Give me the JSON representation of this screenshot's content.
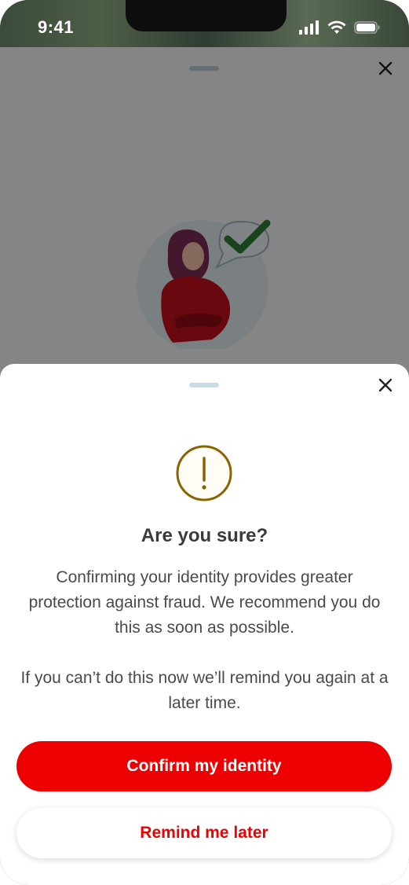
{
  "status_bar": {
    "time": "9:41",
    "icons": [
      "signal-icon",
      "wifi-icon",
      "battery-icon"
    ]
  },
  "background_sheet": {
    "close_icon": "close-icon",
    "illustration": "woman-with-checkmark-illustration"
  },
  "modal": {
    "close_icon": "close-icon",
    "warning_icon": "exclamation-icon",
    "title": "Are you sure?",
    "paragraph1": "Confirming your identity provides greater protection against fraud. We recommend you do this as soon as possible.",
    "paragraph2": "If you can’t do this now we’ll remind you again at a later time.",
    "primary_button": "Confirm my identity",
    "secondary_button": "Remind me later"
  },
  "colors": {
    "accent": "#ec0000",
    "warning": "#8a6400",
    "success": "#2e7d32"
  }
}
